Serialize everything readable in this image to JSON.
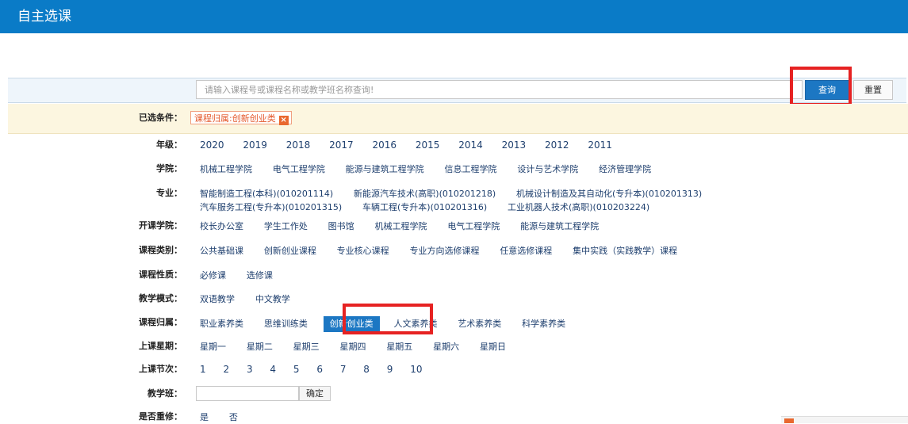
{
  "header": {
    "title": "自主选课"
  },
  "search": {
    "placeholder": "请输入课程号或课程名称或教学班名称查询!",
    "query_label": "查询",
    "reset_label": "重置"
  },
  "selected": {
    "label": "已选条件：",
    "tag": "课程归属:创新创业类",
    "tag_close": "×"
  },
  "filters": {
    "grade": {
      "label": "年级：",
      "options": [
        "2020",
        "2019",
        "2018",
        "2017",
        "2016",
        "2015",
        "2014",
        "2013",
        "2012",
        "2011"
      ]
    },
    "college": {
      "label": "学院：",
      "options": [
        "机械工程学院",
        "电气工程学院",
        "能源与建筑工程学院",
        "信息工程学院",
        "设计与艺术学院",
        "经济管理学院"
      ]
    },
    "major": {
      "label": "专业：",
      "options": [
        "智能制造工程(本科)(010201114)",
        "新能源汽车技术(高职)(010201218)",
        "机械设计制造及其自动化(专升本)(010201313)",
        "汽车服务工程(专升本)(010201315)",
        "车辆工程(专升本)(010201316)",
        "工业机器人技术(高职)(010203224)"
      ]
    },
    "offering": {
      "label": "开课学院：",
      "options": [
        "校长办公室",
        "学生工作处",
        "图书馆",
        "机械工程学院",
        "电气工程学院",
        "能源与建筑工程学院"
      ]
    },
    "category": {
      "label": "课程类别：",
      "options": [
        "公共基础课",
        "创新创业课程",
        "专业核心课程",
        "专业方向选修课程",
        "任意选修课程",
        "集中实践（实践教学）课程"
      ]
    },
    "nature": {
      "label": "课程性质：",
      "options": [
        "必修课",
        "选修课"
      ]
    },
    "mode": {
      "label": "教学模式：",
      "options": [
        "双语教学",
        "中文教学"
      ]
    },
    "belong": {
      "label": "课程归属：",
      "options": [
        "职业素养类",
        "思维训练类",
        "创新创业类",
        "人文素养类",
        "艺术素养类",
        "科学素养类"
      ],
      "active": "创新创业类"
    },
    "weekday": {
      "label": "上课星期：",
      "options": [
        "星期一",
        "星期二",
        "星期三",
        "星期四",
        "星期五",
        "星期六",
        "星期日"
      ]
    },
    "period": {
      "label": "上课节次：",
      "options": [
        "1",
        "2",
        "3",
        "4",
        "5",
        "6",
        "7",
        "8",
        "9",
        "10"
      ]
    },
    "teaching_class": {
      "label": "教学班：",
      "confirm_label": "确定"
    },
    "retake": {
      "label": "是否重修：",
      "options": [
        "是",
        "否"
      ]
    }
  },
  "colors": {
    "header": "#0a7bc7",
    "accent": "#1c77c3",
    "highlight_box": "#e62222",
    "tag": "#e4582b"
  }
}
